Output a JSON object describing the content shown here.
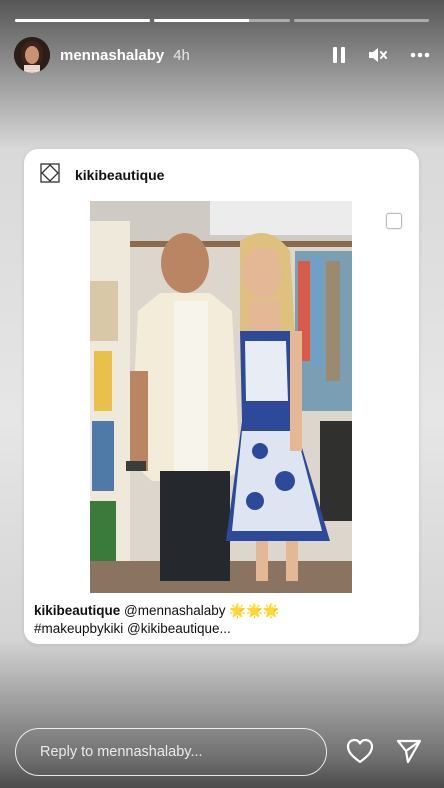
{
  "story": {
    "segments": [
      1,
      0.7,
      0
    ]
  },
  "header": {
    "username": "mennashalaby",
    "time": "4h",
    "icons": [
      "pause-icon",
      "mute-icon",
      "more-icon"
    ]
  },
  "post": {
    "account": "kikibeautique",
    "caption_handle": "kikibeautique",
    "caption_text": " @mennashalaby 🌟🌟🌟",
    "caption_line2": "#makeupbykiki @kikibeautique..."
  },
  "footer": {
    "reply_placeholder": "Reply to mennashalaby...",
    "icons": [
      "heart-icon",
      "send-icon"
    ]
  }
}
